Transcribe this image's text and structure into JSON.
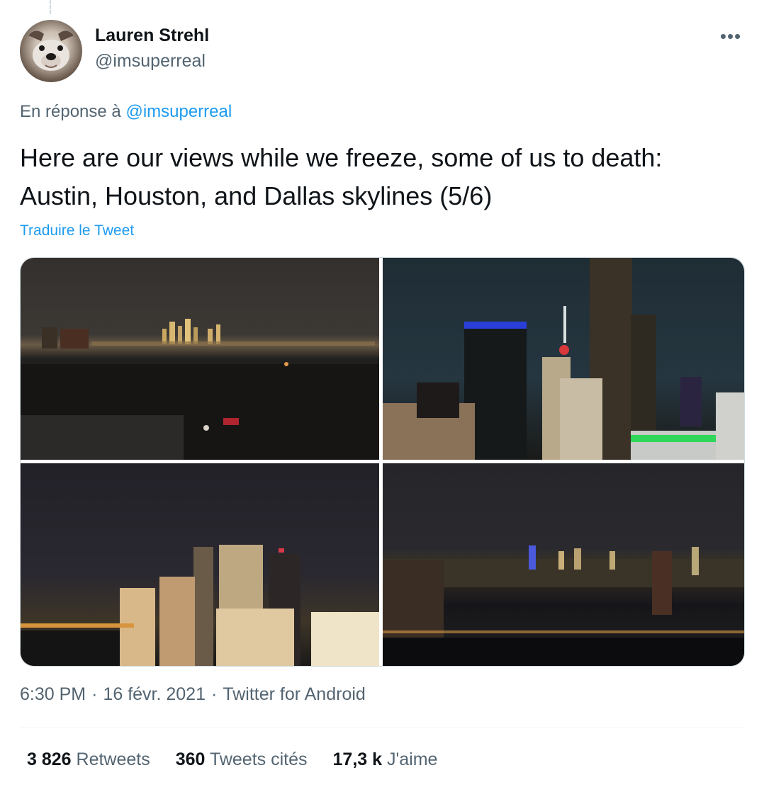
{
  "tweet": {
    "author": {
      "name": "Lauren Strehl",
      "handle": "@imsuperreal"
    },
    "more_icon": "more-horizontal-icon",
    "reply_prefix": "En réponse à",
    "reply_handle": "@imsuperreal",
    "text": "Here are our views while we freeze, some of us to death: Austin, Houston, and Dallas skylines (5/6)",
    "translate_label": "Traduire le Tweet",
    "time": "6:30 PM",
    "date": "16 févr. 2021",
    "source": "Twitter for Android",
    "separator": "·"
  },
  "stats": {
    "retweets": {
      "count": "3 826",
      "label": "Retweets"
    },
    "quotes": {
      "count": "360",
      "label": "Tweets cités"
    },
    "likes": {
      "count": "17,3 k",
      "label": "J'aime"
    }
  },
  "colors": {
    "accent": "#1d9bf0",
    "secondary_text": "#536471",
    "primary_text": "#0f1419"
  }
}
